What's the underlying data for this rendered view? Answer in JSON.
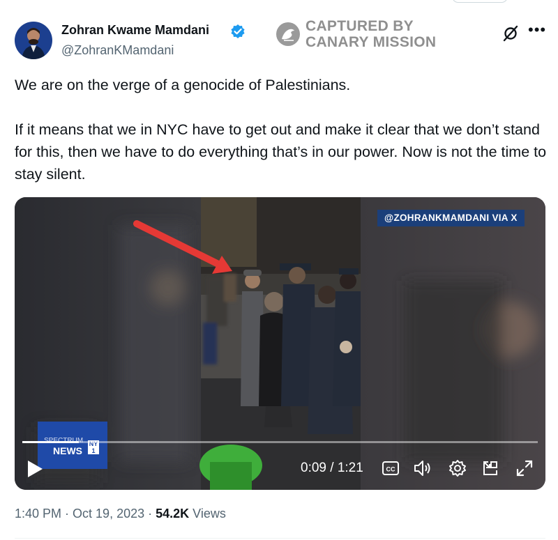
{
  "author": {
    "display_name": "Zohran Kwame Mamdani",
    "handle": "@ZohranKMamdani",
    "verified_icon": "verified-badge-icon"
  },
  "watermark": {
    "line1": "CAPTURED BY",
    "line2": "CANARY MISSION",
    "color": "#8f8f8f"
  },
  "tweet": {
    "paragraph1": "We are on the verge of a genocide of Palestinians.",
    "paragraph2": "If it means that we in NYC have to get out and make it clear that we don’t stand for this, then we have to do everything that’s in our power. Now is not the time to stay silent."
  },
  "video": {
    "source_tag": "@ZOHRANKMAMDANI VIA X",
    "news_logo_small": "SPECTRUM",
    "news_logo_badge": "NY",
    "news_logo_main": "NEWS",
    "news_logo_badge_num": "1",
    "current_time": "0:09",
    "duration": "1:21",
    "time_display": "0:09 / 1:21",
    "progress_fraction": 0.11,
    "controls": [
      "play-icon",
      "captions-icon",
      "volume-icon",
      "settings-icon",
      "pip-icon",
      "fullscreen-icon"
    ]
  },
  "footer": {
    "time": "1:40 PM",
    "sep1": " · ",
    "date": "Oct 19, 2023",
    "sep2": " · ",
    "views_count": "54.2K",
    "views_label": " Views"
  },
  "colors": {
    "text": "#0f1419",
    "muted": "#536471",
    "verified": "#1d9bf0",
    "annotation_arrow": "#e53935",
    "news_tag_bg": "#1b3f7a"
  }
}
